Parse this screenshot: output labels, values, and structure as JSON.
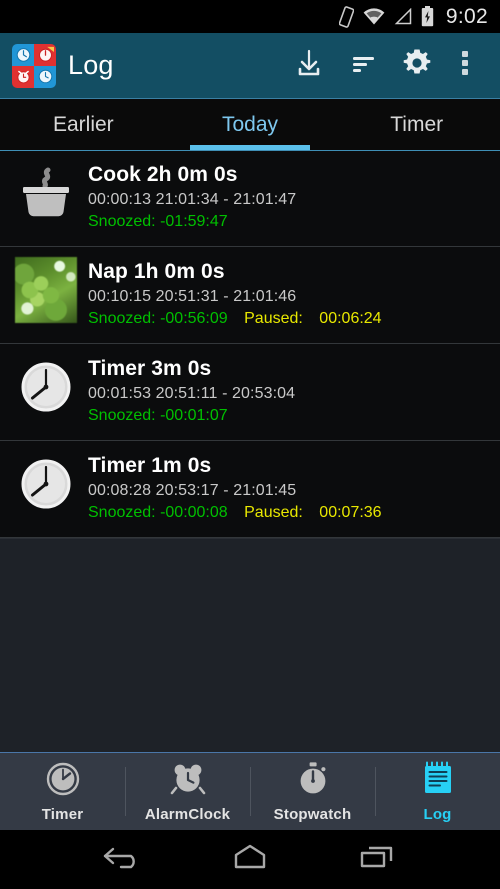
{
  "statusbar": {
    "time": "9:02",
    "icons": [
      "vibrate-icon",
      "wifi-icon",
      "cell-signal-icon",
      "battery-charging-icon"
    ]
  },
  "toolbar": {
    "title": "Log",
    "app_icon": "app-logo-icon",
    "accent_color": "#134E63",
    "actions": [
      {
        "name": "download-button",
        "icon": "download-icon"
      },
      {
        "name": "sort-button",
        "icon": "sort-icon"
      },
      {
        "name": "settings-button",
        "icon": "gear-icon"
      },
      {
        "name": "overflow-button",
        "icon": "overflow-menu-icon"
      }
    ]
  },
  "tabs": {
    "active_index": 1,
    "active_color": "#5BC0EB",
    "items": [
      {
        "label": "Earlier"
      },
      {
        "label": "Today"
      },
      {
        "label": "Timer"
      }
    ]
  },
  "list": {
    "snoozed_label": "Snoozed:",
    "paused_label": "Paused:",
    "snoozed_color": "#00C000",
    "paused_color": "#E8E800",
    "entries": [
      {
        "icon": "cooking-pot-icon",
        "title": "Cook 2h 0m 0s",
        "elapsed": "00:00:13",
        "range": "21:01:34 - 21:01:47",
        "times": "00:00:13  21:01:34 - 21:01:47",
        "snoozed": "-01:59:47",
        "paused": ""
      },
      {
        "icon": "photo-thumbnail-grapes",
        "title": "Nap 1h 0m 0s",
        "elapsed": "00:10:15",
        "range": "20:51:31 - 21:01:46",
        "times": "00:10:15  20:51:31 - 21:01:46",
        "snoozed": "-00:56:09",
        "paused": "00:06:24"
      },
      {
        "icon": "timer-clock-icon",
        "title": "Timer 3m 0s",
        "elapsed": "00:01:53",
        "range": "20:51:11 - 20:53:04",
        "times": "00:01:53  20:51:11 - 20:53:04",
        "snoozed": "-00:01:07",
        "paused": ""
      },
      {
        "icon": "timer-clock-icon",
        "title": "Timer 1m 0s",
        "elapsed": "00:08:28",
        "range": "20:53:17 - 21:01:45",
        "times": "00:08:28  20:53:17 - 21:01:45",
        "snoozed": "-00:00:08",
        "paused": "00:07:36"
      }
    ]
  },
  "bottomnav": {
    "active_index": 3,
    "active_color": "#27D0F5",
    "items": [
      {
        "label": "Timer",
        "icon": "timer-icon"
      },
      {
        "label": "AlarmClock",
        "icon": "alarm-clock-icon"
      },
      {
        "label": "Stopwatch",
        "icon": "stopwatch-icon"
      },
      {
        "label": "Log",
        "icon": "notepad-icon"
      }
    ]
  },
  "androidnav": {
    "items": [
      {
        "name": "back-button",
        "icon": "back-arrow-icon"
      },
      {
        "name": "home-button",
        "icon": "home-icon"
      },
      {
        "name": "recents-button",
        "icon": "recents-icon"
      }
    ]
  }
}
